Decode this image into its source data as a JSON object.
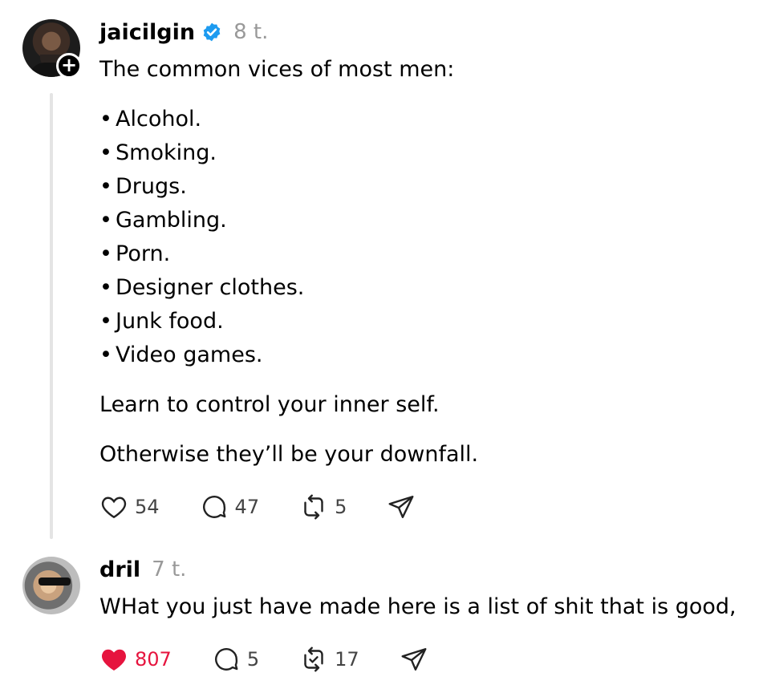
{
  "posts": [
    {
      "author": "jaicilgin",
      "verified": true,
      "time": "8 t.",
      "follow_glyph": "+",
      "lead": "The common vices of most men:",
      "list": [
        "Alcohol.",
        "Smoking.",
        "Drugs.",
        "Gambling.",
        "Porn.",
        "Designer clothes.",
        "Junk food.",
        "Video games."
      ],
      "bullet": "•",
      "para1": "Learn to control your inner self.",
      "para2": "Otherwise they’ll be your downfall.",
      "likes": "54",
      "replies": "47",
      "reposts": "5",
      "liked": false
    },
    {
      "author": "dril",
      "time": "7 t.",
      "lead": "WHat you just have made here is a list of shit that is good,",
      "likes": "807",
      "replies": "5",
      "reposts": "17",
      "liked": true
    }
  ],
  "colors": {
    "like_active": "#e6143e",
    "verified_blue": "#1d9bf0",
    "timestamp": "#999999",
    "thread_line": "#e4e4e4"
  },
  "icons": {
    "like": "heart-icon",
    "reply": "comment-bubble-icon",
    "repost": "repost-arrows-icon",
    "share": "send-plane-icon",
    "verified": "verified-badge-icon"
  }
}
